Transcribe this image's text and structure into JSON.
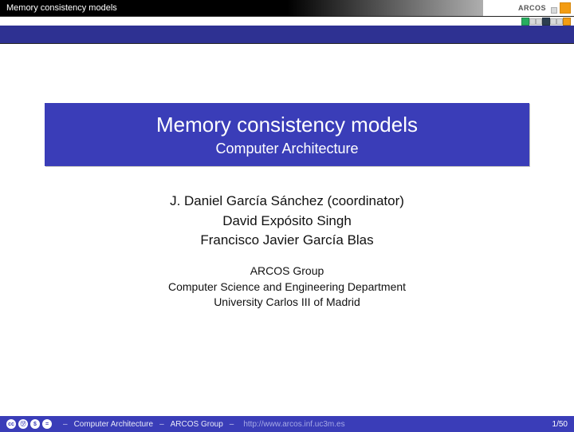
{
  "topbar": {
    "title": "Memory consistency models",
    "logo_text": "ARCOS"
  },
  "title": {
    "main": "Memory consistency models",
    "sub": "Computer Architecture"
  },
  "authors": [
    "J. Daniel García Sánchez (coordinator)",
    "David Expósito Singh",
    "Francisco Javier García Blas"
  ],
  "affiliation": [
    "ARCOS Group",
    "Computer Science and Engineering Department",
    "University Carlos III of Madrid"
  ],
  "footer": {
    "cc_icons": [
      "cc",
      "㋡",
      "$",
      "="
    ],
    "sep": "–",
    "course": "Computer Architecture",
    "group": "ARCOS Group",
    "url": "http://www.arcos.inf.uc3m.es",
    "page": "1/50"
  }
}
